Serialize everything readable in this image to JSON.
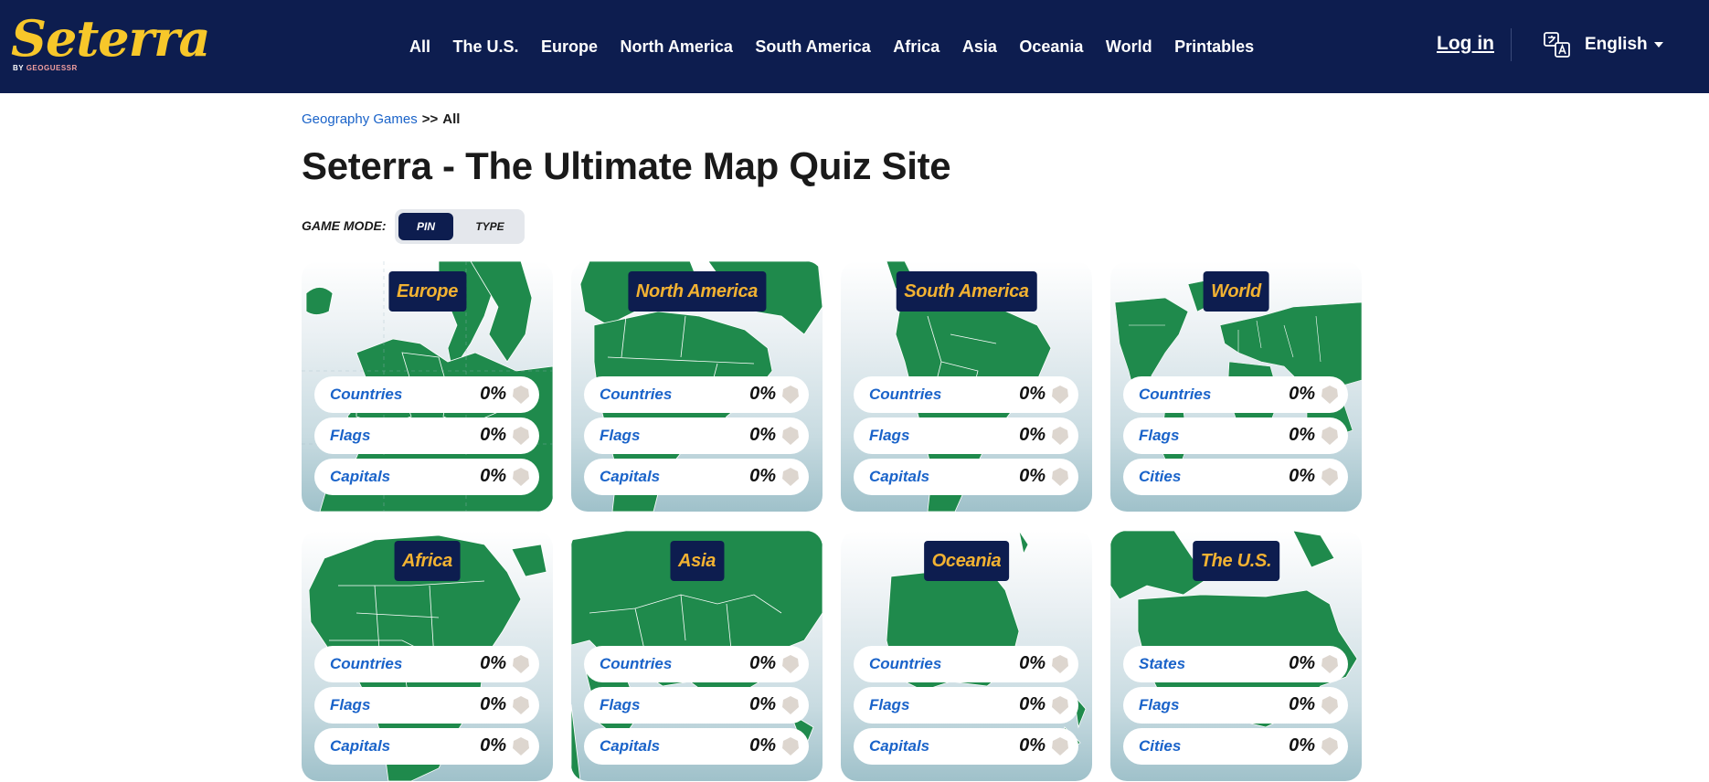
{
  "header": {
    "logo_text": "Seterra",
    "logo_by": "BY",
    "logo_brand": "GEOGUESSR",
    "nav": [
      "All",
      "The U.S.",
      "Europe",
      "North America",
      "South America",
      "Africa",
      "Asia",
      "Oceania",
      "World",
      "Printables"
    ],
    "login_label": "Log in",
    "language_icon": "translate-icon",
    "language_label": "English"
  },
  "breadcrumb": {
    "link": "Geography Games",
    "separator": ">>",
    "current": "All"
  },
  "page_title": "Seterra - The Ultimate Map Quiz Site",
  "game_mode": {
    "label": "GAME MODE:",
    "options": [
      "PIN",
      "TYPE"
    ],
    "selected": "PIN"
  },
  "colors": {
    "header_bg": "#0d1d4f",
    "land": "#1f8a4c",
    "title_text": "#f2b232",
    "link": "#1a63c9"
  },
  "cards": [
    {
      "title": "Europe",
      "rows": [
        {
          "label": "Countries",
          "pct": "0%"
        },
        {
          "label": "Flags",
          "pct": "0%"
        },
        {
          "label": "Capitals",
          "pct": "0%"
        }
      ]
    },
    {
      "title": "North America",
      "rows": [
        {
          "label": "Countries",
          "pct": "0%"
        },
        {
          "label": "Flags",
          "pct": "0%"
        },
        {
          "label": "Capitals",
          "pct": "0%"
        }
      ]
    },
    {
      "title": "South America",
      "rows": [
        {
          "label": "Countries",
          "pct": "0%"
        },
        {
          "label": "Flags",
          "pct": "0%"
        },
        {
          "label": "Capitals",
          "pct": "0%"
        }
      ]
    },
    {
      "title": "World",
      "rows": [
        {
          "label": "Countries",
          "pct": "0%"
        },
        {
          "label": "Flags",
          "pct": "0%"
        },
        {
          "label": "Cities",
          "pct": "0%"
        }
      ]
    },
    {
      "title": "Africa",
      "rows": [
        {
          "label": "Countries",
          "pct": "0%"
        },
        {
          "label": "Flags",
          "pct": "0%"
        },
        {
          "label": "Capitals",
          "pct": "0%"
        }
      ]
    },
    {
      "title": "Asia",
      "rows": [
        {
          "label": "Countries",
          "pct": "0%"
        },
        {
          "label": "Flags",
          "pct": "0%"
        },
        {
          "label": "Capitals",
          "pct": "0%"
        }
      ]
    },
    {
      "title": "Oceania",
      "rows": [
        {
          "label": "Countries",
          "pct": "0%"
        },
        {
          "label": "Flags",
          "pct": "0%"
        },
        {
          "label": "Capitals",
          "pct": "0%"
        }
      ]
    },
    {
      "title": "The U.S.",
      "rows": [
        {
          "label": "States",
          "pct": "0%"
        },
        {
          "label": "Flags",
          "pct": "0%"
        },
        {
          "label": "Cities",
          "pct": "0%"
        }
      ]
    }
  ]
}
